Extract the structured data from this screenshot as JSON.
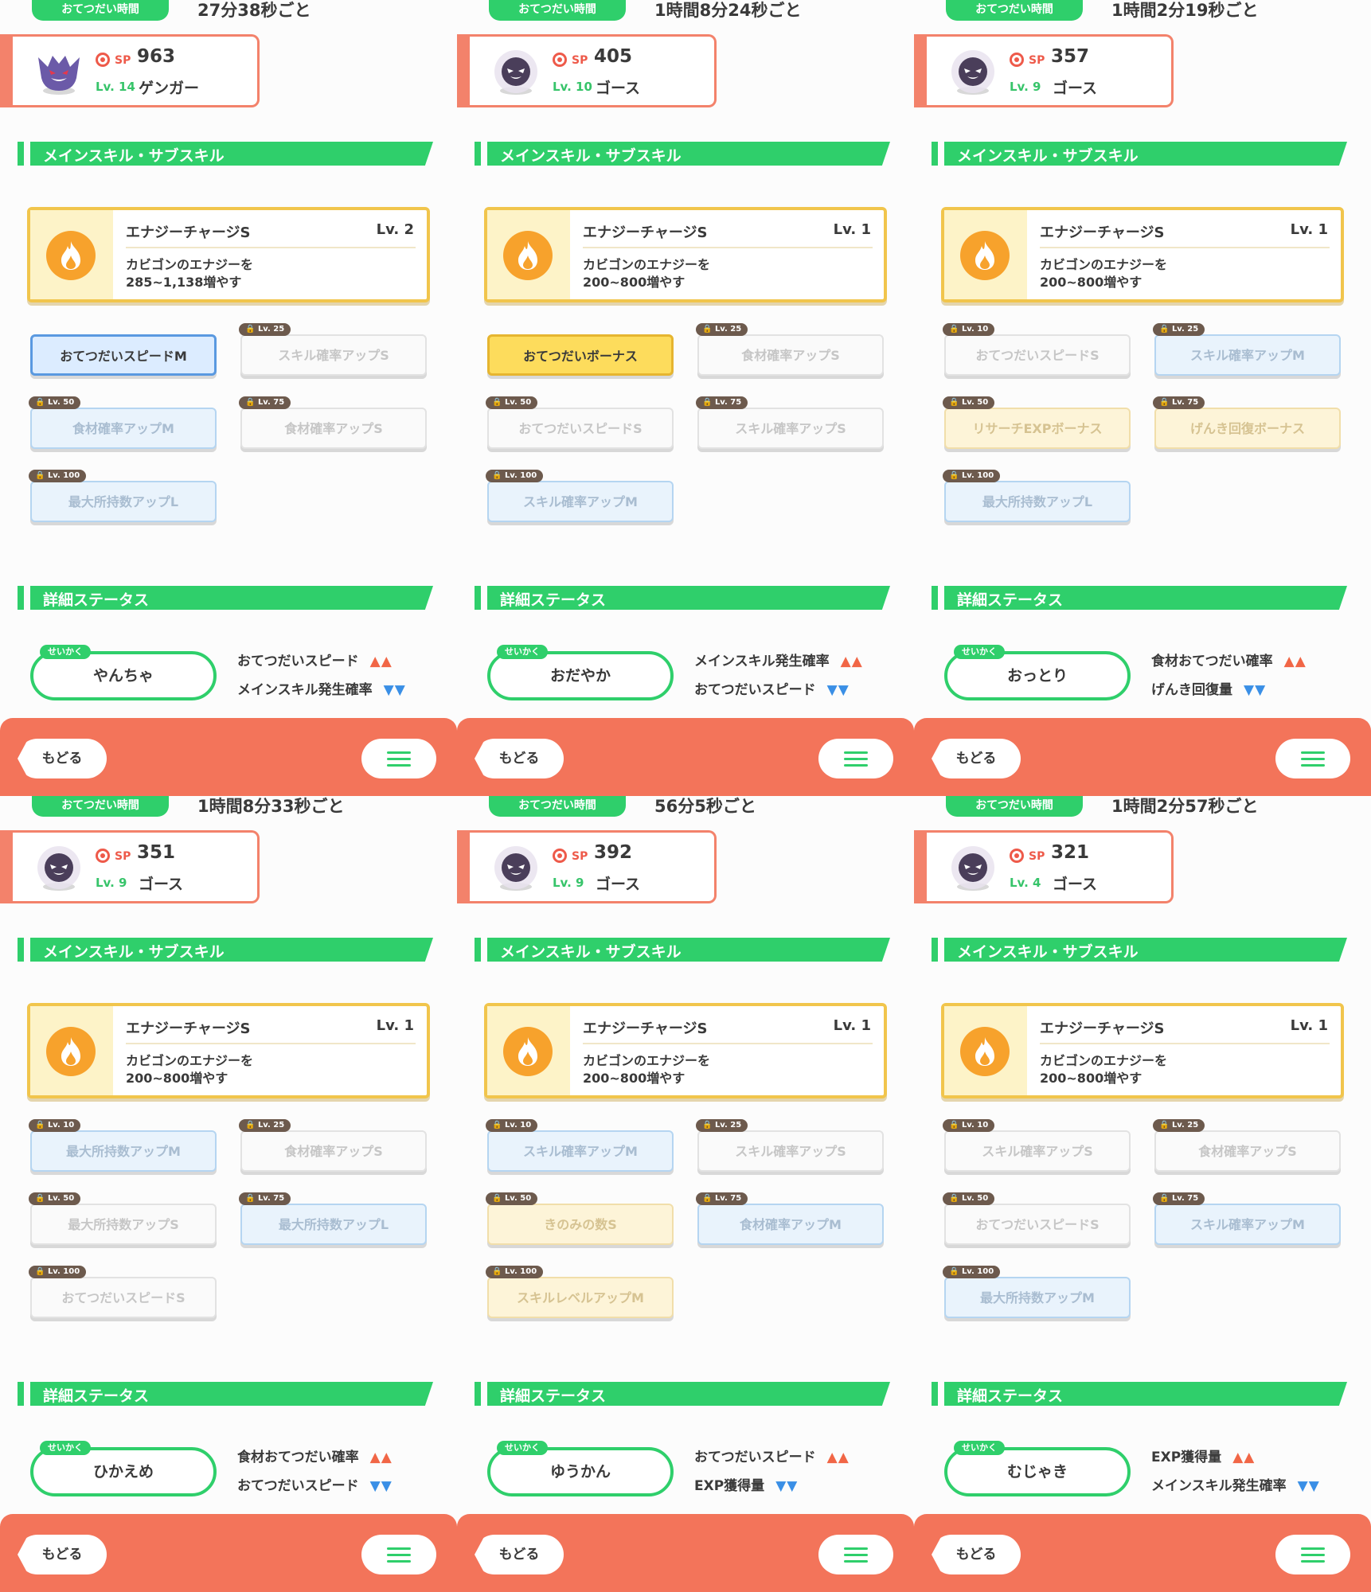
{
  "common": {
    "help_time_label": "おてつだい時間",
    "sp_label": "SP",
    "lv_prefix": "Lv.",
    "main_sub_header": "メインスキル・サブスキル",
    "detail_header": "詳細ステータス",
    "nature_small_label": "せいかく",
    "back_label": "もどる",
    "menu_icon": "hamburger-menu-icon",
    "accent_green": "#2fcf6b",
    "accent_coral": "#f3745a"
  },
  "panels": [
    {
      "help_time": "27分38秒ごと",
      "sp": "963",
      "lv": "Lv. 14",
      "name": "ゲンガー",
      "skill": {
        "name": "エナジーチャージS",
        "level": "Lv. 2",
        "desc1": "カビゴンのエナジーを",
        "desc2": "285~1,138増やす"
      },
      "subskills": [
        {
          "unlock": "",
          "name": "おてつだいスピードM",
          "style": "blue-active"
        },
        {
          "unlock": "Lv. 25",
          "name": "スキル確率アップS",
          "style": "gray"
        },
        {
          "unlock": "Lv. 50",
          "name": "食材確率アップM",
          "style": "blue"
        },
        {
          "unlock": "Lv. 75",
          "name": "食材確率アップS",
          "style": "gray"
        },
        {
          "unlock": "Lv. 100",
          "name": "最大所持数アップL",
          "style": "blue"
        }
      ],
      "nature": "やんちゃ",
      "stat_up": "おてつだいスピード",
      "stat_down": "メインスキル発生確率"
    },
    {
      "help_time": "1時間8分24秒ごと",
      "sp": "405",
      "lv": "Lv. 10",
      "name": "ゴース",
      "skill": {
        "name": "エナジーチャージS",
        "level": "Lv. 1",
        "desc1": "カビゴンのエナジーを",
        "desc2": "200~800増やす"
      },
      "subskills": [
        {
          "unlock": "",
          "name": "おてつだいボーナス",
          "style": "gold-active"
        },
        {
          "unlock": "Lv. 25",
          "name": "食材確率アップS",
          "style": "gray"
        },
        {
          "unlock": "Lv. 50",
          "name": "おてつだいスピードS",
          "style": "gray"
        },
        {
          "unlock": "Lv. 75",
          "name": "スキル確率アップS",
          "style": "gray"
        },
        {
          "unlock": "Lv. 100",
          "name": "スキル確率アップM",
          "style": "blue"
        }
      ],
      "nature": "おだやか",
      "stat_up": "メインスキル発生確率",
      "stat_down": "おてつだいスピード"
    },
    {
      "help_time": "1時間2分19秒ごと",
      "sp": "357",
      "lv": "Lv. 9",
      "name": "ゴース",
      "skill": {
        "name": "エナジーチャージS",
        "level": "Lv. 1",
        "desc1": "カビゴンのエナジーを",
        "desc2": "200~800増やす"
      },
      "subskills": [
        {
          "unlock": "Lv. 10",
          "name": "おてつだいスピードS",
          "style": "gray"
        },
        {
          "unlock": "Lv. 25",
          "name": "スキル確率アップM",
          "style": "blue"
        },
        {
          "unlock": "Lv. 50",
          "name": "リサーチEXPボーナス",
          "style": "gold"
        },
        {
          "unlock": "Lv. 75",
          "name": "げんき回復ボーナス",
          "style": "gold"
        },
        {
          "unlock": "Lv. 100",
          "name": "最大所持数アップL",
          "style": "blue"
        }
      ],
      "nature": "おっとり",
      "stat_up": "食材おてつだい確率",
      "stat_down": "げんき回復量"
    },
    {
      "help_time": "1時間8分33秒ごと",
      "sp": "351",
      "lv": "Lv. 9",
      "name": "ゴース",
      "skill": {
        "name": "エナジーチャージS",
        "level": "Lv. 1",
        "desc1": "カビゴンのエナジーを",
        "desc2": "200~800増やす"
      },
      "subskills": [
        {
          "unlock": "Lv. 10",
          "name": "最大所持数アップM",
          "style": "blue"
        },
        {
          "unlock": "Lv. 25",
          "name": "食材確率アップS",
          "style": "gray"
        },
        {
          "unlock": "Lv. 50",
          "name": "最大所持数アップS",
          "style": "gray"
        },
        {
          "unlock": "Lv. 75",
          "name": "最大所持数アップL",
          "style": "blue"
        },
        {
          "unlock": "Lv. 100",
          "name": "おてつだいスピードS",
          "style": "gray"
        }
      ],
      "nature": "ひかえめ",
      "stat_up": "食材おてつだい確率",
      "stat_down": "おてつだいスピード"
    },
    {
      "help_time": "56分5秒ごと",
      "sp": "392",
      "lv": "Lv. 9",
      "name": "ゴース",
      "skill": {
        "name": "エナジーチャージS",
        "level": "Lv. 1",
        "desc1": "カビゴンのエナジーを",
        "desc2": "200~800増やす"
      },
      "subskills": [
        {
          "unlock": "Lv. 10",
          "name": "スキル確率アップM",
          "style": "blue"
        },
        {
          "unlock": "Lv. 25",
          "name": "スキル確率アップS",
          "style": "gray"
        },
        {
          "unlock": "Lv. 50",
          "name": "きのみの数S",
          "style": "gold"
        },
        {
          "unlock": "Lv. 75",
          "name": "食材確率アップM",
          "style": "blue"
        },
        {
          "unlock": "Lv. 100",
          "name": "スキルレベルアップM",
          "style": "gold"
        }
      ],
      "nature": "ゆうかん",
      "stat_up": "おてつだいスピード",
      "stat_down": "EXP獲得量"
    },
    {
      "help_time": "1時間2分57秒ごと",
      "sp": "321",
      "lv": "Lv. 4",
      "name": "ゴース",
      "skill": {
        "name": "エナジーチャージS",
        "level": "Lv. 1",
        "desc1": "カビゴンのエナジーを",
        "desc2": "200~800増やす"
      },
      "subskills": [
        {
          "unlock": "Lv. 10",
          "name": "スキル確率アップS",
          "style": "gray"
        },
        {
          "unlock": "Lv. 25",
          "name": "食材確率アップS",
          "style": "gray"
        },
        {
          "unlock": "Lv. 50",
          "name": "おてつだいスピードS",
          "style": "gray"
        },
        {
          "unlock": "Lv. 75",
          "name": "スキル確率アップM",
          "style": "blue"
        },
        {
          "unlock": "Lv. 100",
          "name": "最大所持数アップM",
          "style": "blue"
        }
      ],
      "nature": "むじゃき",
      "stat_up": "EXP獲得量",
      "stat_down": "メインスキル発生確率"
    }
  ]
}
